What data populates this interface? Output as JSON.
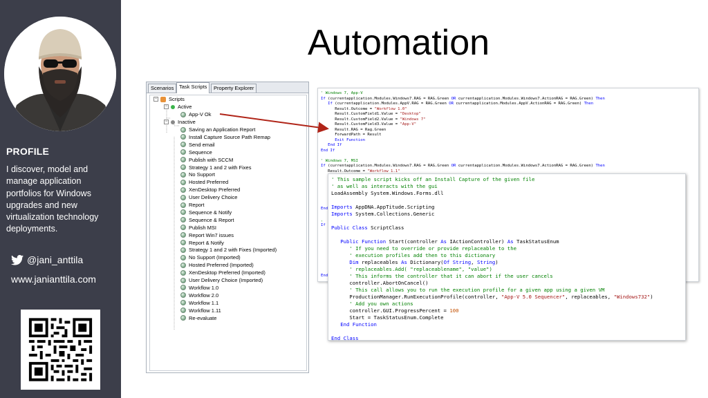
{
  "slide": {
    "title": "Automation"
  },
  "colors": {
    "sidebar_bg": "#3c3e4a",
    "arrow": "#b02418"
  },
  "profile": {
    "heading": "PROFILE",
    "bio_lines": [
      "I discover, model and",
      "manage application",
      "portfolios for Windows",
      "upgrades and new",
      "virtualization technology",
      "deployments."
    ],
    "twitter_icon": "twitter-bird-icon",
    "twitter_handle": "@jani_anttila",
    "website": "www.janianttila.com"
  },
  "tree_panel": {
    "tabs": [
      "Scenarios",
      "Task Scripts",
      "Property Explorer"
    ],
    "active_tab": "Task Scripts",
    "root": "Scripts",
    "active_group": "Active",
    "active_items": [
      "App-V Ok"
    ],
    "inactive_group": "Inactive",
    "inactive_items": [
      "Saving an Application Report",
      "Install Capture Source Path Remap",
      "Send email",
      "Sequence",
      "Publish with SCCM",
      "Strategy 1 and 2 with Fixes",
      "No Support",
      "Hosted Preferred",
      "XenDesktop Preferred",
      "User Delivery Choice",
      "Report",
      "Sequence & Notify",
      "Sequence & Report",
      "Publish MSI",
      "Report Win7 issues",
      "Report & Notify",
      "Strategy 1 and 2 with Fixes (Imported)",
      "No Support (Imported)",
      "Hosted Preferred (Imported)",
      "XenDesktop Preferred (Imported)",
      "User Delivery Choice (Imported)",
      "Workflow 1.0",
      "Workflow 2.0",
      "Workflow 1.1",
      "Workflow 1.11",
      "Re-evaluate"
    ]
  },
  "code_back": {
    "lines": [
      "' Windows 7, App-V",
      "If (currentapplication.Modules.Windows7.RAG = RAG.Green OR currentapplication.Modules.Windows7.ActionRAG = RAG.Green) Then",
      "   If (currentapplication.Modules.AppV.RAG = RAG.Green OR currentapplication.Modules.AppV.ActionRAG = RAG.Green) Then",
      "      Result.Outcome = \"Workflow 1.0\"",
      "      Result.CustomField1.Value = \"Desktop\"",
      "      Result.CustomField2.Value = \"Windows 7\"",
      "      Result.CustomField3.Value = \"App-V\"",
      "      Result.RAG = Rag.Green",
      "      ForwardPath = Result",
      "      Exit Function",
      "   End If",
      "End If",
      "",
      "' Windows 7, MSI",
      "If (currentapplication.Modules.Windows7.RAG = RAG.Green OR currentapplication.Modules.Windows7.ActionRAG = RAG.Green) Then",
      "   Result.Outcome = \"Workflow 1.1\""
    ],
    "margin_fragments": [
      "End",
      "'",
      "If",
      "End"
    ]
  },
  "code_front": {
    "lines": [
      "' This sample script kicks off an Install Capture of the given file",
      "' as well as interacts with the gui",
      "LoadAssembly System.Windows.Forms.dll",
      "",
      "Imports AppDNA.AppTitude.Scripting",
      "Imports System.Collections.Generic",
      "",
      "Public Class ScriptClass",
      "",
      "   Public Function Start(controller As IActionController) As TaskStatusEnum",
      "      ' If you need to override or provide replaceable to the",
      "      ' execution profiles add then to this dictionary",
      "      Dim replaceables As Dictionary(Of String, String)",
      "      ' replaceables.Add( \"replaceablename\", \"value\")",
      "      ' This informs the controller that it can abort if the user cancels",
      "      controller.AbortOnCancel()",
      "      ' This call allows you to run the execution profile for a given app using a given VM",
      "      ProductionManager.RunExecutionProfile(controller, \"App-V 5.0 Sequencer\", replaceables, \"Windows732\")",
      "      ' Add you own actions",
      "      controller.GUI.ProgressPercent = 100",
      "      Start = TaskStatusEnum.Complete",
      "   End Function",
      "",
      "End Class"
    ]
  }
}
